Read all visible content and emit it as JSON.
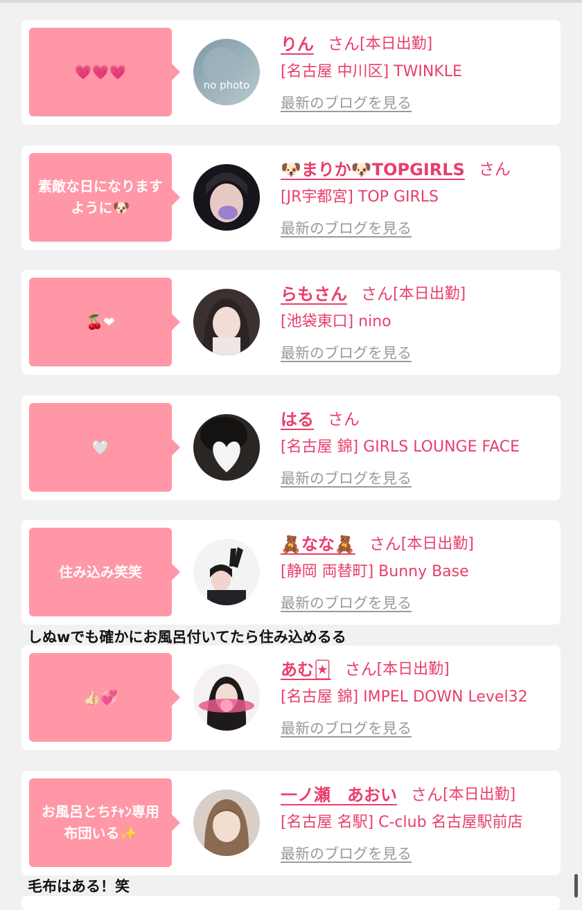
{
  "suffix": "さん",
  "blog_link": "最新のブログを見る",
  "entries": [
    {
      "comment": "💗💗💗",
      "name": "りん",
      "status": "[本日出勤]",
      "shop": "[名古屋 中川区] TWINKLE"
    },
    {
      "comment": "素敵な日になりますように🐶",
      "name": "🐶まりか🐶TOPGIRLS",
      "status": "",
      "shop": "[JR宇都宮] TOP GIRLS"
    },
    {
      "comment": "🍒❤",
      "name": "らもさん",
      "status": "[本日出勤]",
      "shop": "[池袋東口] nino"
    },
    {
      "comment": "🤍",
      "name": "はる",
      "status": "",
      "shop": "[名古屋 錦] GIRLS LOUNGE FACE"
    },
    {
      "comment": "住み込み笑笑",
      "name": "🧸なな🧸",
      "status": "[本日出勤]",
      "shop": "[静岡 両替町] Bunny Base"
    },
    {
      "comment": "👍🏻💞",
      "name": "あむ🃏",
      "status": "[本日出勤]",
      "shop": "[名古屋 錦] IMPEL DOWN Level32"
    },
    {
      "comment": "お風呂とちﾁｬﾝ専用布団いる✨",
      "name": "一ノ瀬　あおい",
      "status": "[本日出勤]",
      "shop": "[名古屋 名駅] C-club 名古屋駅前店"
    }
  ],
  "captions": [
    "しぬwでも確かにお風呂付いてたら住み込めるる",
    "毛布はある！笑"
  ],
  "avatar_labels": {
    "no_photo": "no photo"
  },
  "colors": {
    "accent": "#e83e6a",
    "bubble": "#ff97a6",
    "link": "#999999",
    "background": "#f1f1f1"
  }
}
